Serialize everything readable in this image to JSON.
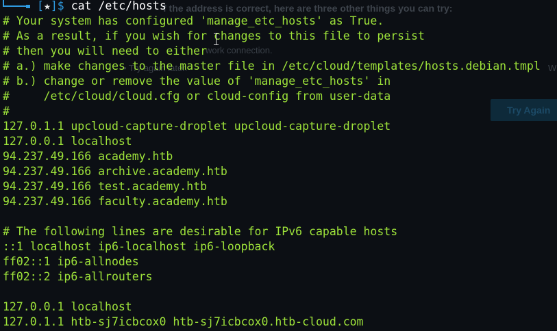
{
  "background_page": {
    "heading": "f the address is correct, here are three other things you can try:",
    "line1": "work connection.",
    "line2": "• Try again later.",
    "trail": "W",
    "button_label": "Try Again"
  },
  "terminal": {
    "prompt": {
      "open": "[",
      "star": "★",
      "close": "]$ ",
      "command": "cat /etc/hosts"
    },
    "lines": [
      "# Your system has configured 'manage_etc_hosts' as True.",
      "# As a result, if you wish for changes to this file to persist",
      "# then you will need to either",
      "# a.) make changes to the master file in /etc/cloud/templates/hosts.debian.tmpl",
      "# b.) change or remove the value of 'manage_etc_hosts' in",
      "#     /etc/cloud/cloud.cfg or cloud-config from user-data",
      "#",
      "127.0.1.1 upcloud-capture-droplet upcloud-capture-droplet",
      "127.0.0.1 localhost",
      "94.237.49.166 academy.htb",
      "94.237.49.166 archive.academy.htb",
      "94.237.49.166 test.academy.htb",
      "94.237.49.166 faculty.academy.htb",
      "",
      "# The following lines are desirable for IPv6 capable hosts",
      "::1 localhost ip6-localhost ip6-loopback",
      "ff02::1 ip6-allnodes",
      "ff02::2 ip6-allrouters",
      "",
      "127.0.0.1 localhost",
      "127.0.1.1 htb-sj7icbcox0 htb-sj7icbcox0.htb-cloud.com"
    ]
  },
  "colors": {
    "background": "#0c0f14",
    "output_text": "#9ee33a",
    "prompt_blue": "#2f9adf"
  }
}
